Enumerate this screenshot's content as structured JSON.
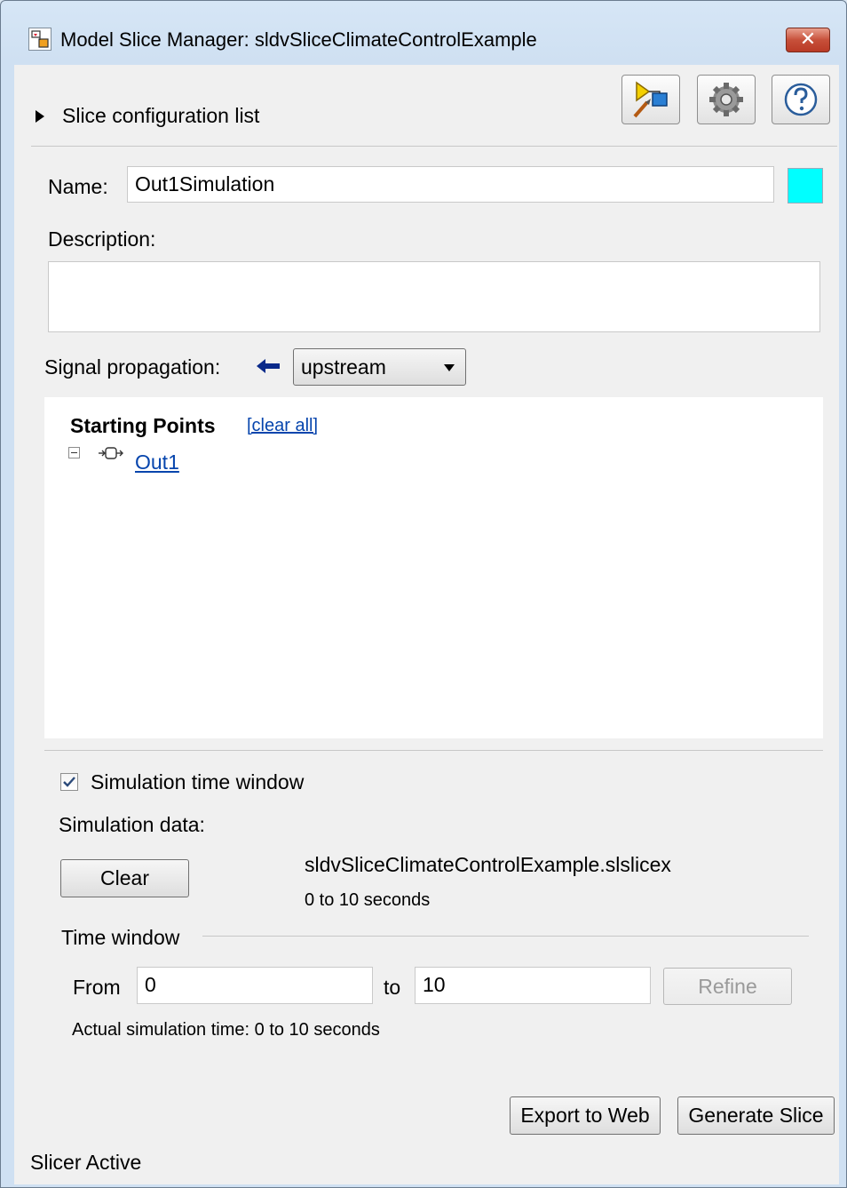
{
  "window": {
    "title": "Model Slice Manager: sldvSliceClimateControlExample",
    "close_glyph": "✕"
  },
  "config_list": {
    "label": "Slice configuration list"
  },
  "toolbar": {
    "icons": [
      "slice-highlight-icon",
      "gear-icon",
      "help-icon"
    ]
  },
  "form": {
    "name_label": "Name:",
    "name_value": "Out1Simulation",
    "color_swatch": "#00ffff",
    "description_label": "Description:",
    "description_value": "",
    "signal_label": "Signal propagation:",
    "signal_value": "upstream"
  },
  "starting_points": {
    "heading": "Starting Points",
    "clear_all": "[clear all]",
    "items": [
      "Out1"
    ]
  },
  "simulation": {
    "checkbox_label": "Simulation time window",
    "checked": true,
    "data_label": "Simulation data:",
    "clear_button": "Clear",
    "file_name": "sldvSliceClimateControlExample.slslicex",
    "range_text": "0 to 10 seconds"
  },
  "time_window": {
    "group_label": "Time window",
    "from_label": "From",
    "from_value": "0",
    "to_label": "to",
    "to_value": "10",
    "refine_button": "Refine",
    "actual_text": "Actual simulation time: 0 to 10 seconds"
  },
  "actions": {
    "export_button": "Export to Web",
    "generate_button": "Generate Slice"
  },
  "status": {
    "text": "Slicer Active"
  }
}
